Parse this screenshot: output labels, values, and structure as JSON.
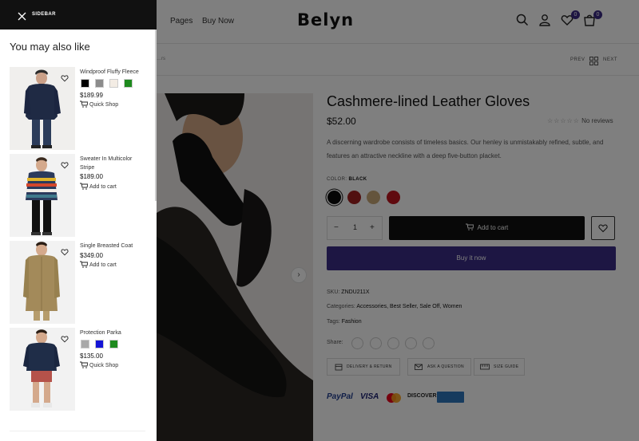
{
  "header": {
    "nav": [
      "Pages",
      "Buy Now"
    ],
    "logo": "Belyn",
    "wishlist_count": "0",
    "cart_count": "0"
  },
  "subbar": {
    "prev": "PREV",
    "next": "NEXT"
  },
  "product": {
    "title": "Cashmere-lined Leather Gloves",
    "price": "$52.00",
    "rating_text": "No reviews",
    "stars": "☆☆☆☆☆",
    "description": "A discerning wardrobe consists of timeless basics. Our henley is unmistakably refined, subtle, and features an attractive neckline with a deep five-button placket.",
    "color_label": "COLOR:",
    "color_value": "BLACK",
    "swatches": [
      "#0a0a0a",
      "#a32020",
      "#c8a878",
      "#c0141e"
    ],
    "quantity": "1",
    "add_to_cart": "Add to cart",
    "buy_now": "Buy it now",
    "sku_label": "SKU:",
    "sku_value": "ZNDU211X",
    "categories_label": "Categories:",
    "categories_value": "Accessories, Best Seller, Sale Off, Women",
    "tags_label": "Tags:",
    "tags_value": "Fashion",
    "share_label": "Share:",
    "actions": [
      "DELIVERY & RETURN",
      "ASK A QUESTION",
      "SIZE GUIDE"
    ],
    "payments": [
      "PayPal",
      "VISA",
      "DISCOVER"
    ]
  },
  "sidebar": {
    "title": "SIDEBAR",
    "heading": "You may also like",
    "products": [
      {
        "name": "Windproof Fluffy Fleece",
        "price": "$189.99",
        "action": "Quick Shop",
        "swatches": [
          "#000000",
          "#8c8c8c",
          "#f3ece4",
          "#1e8a1e"
        ]
      },
      {
        "name": "Sweater In Multicolor Stripe",
        "price": "$189.00",
        "action": "Add to cart",
        "swatches": []
      },
      {
        "name": "Single Breasted Coat",
        "price": "$349.00",
        "action": "Add to cart",
        "swatches": []
      },
      {
        "name": "Protection Parka",
        "price": "$135.00",
        "action": "Quick Shop",
        "swatches": [
          "#a9a9a9",
          "#1414d6",
          "#1e8a1e"
        ]
      }
    ]
  },
  "colors": {
    "accent": "#3a2d86",
    "dark": "#111111"
  }
}
